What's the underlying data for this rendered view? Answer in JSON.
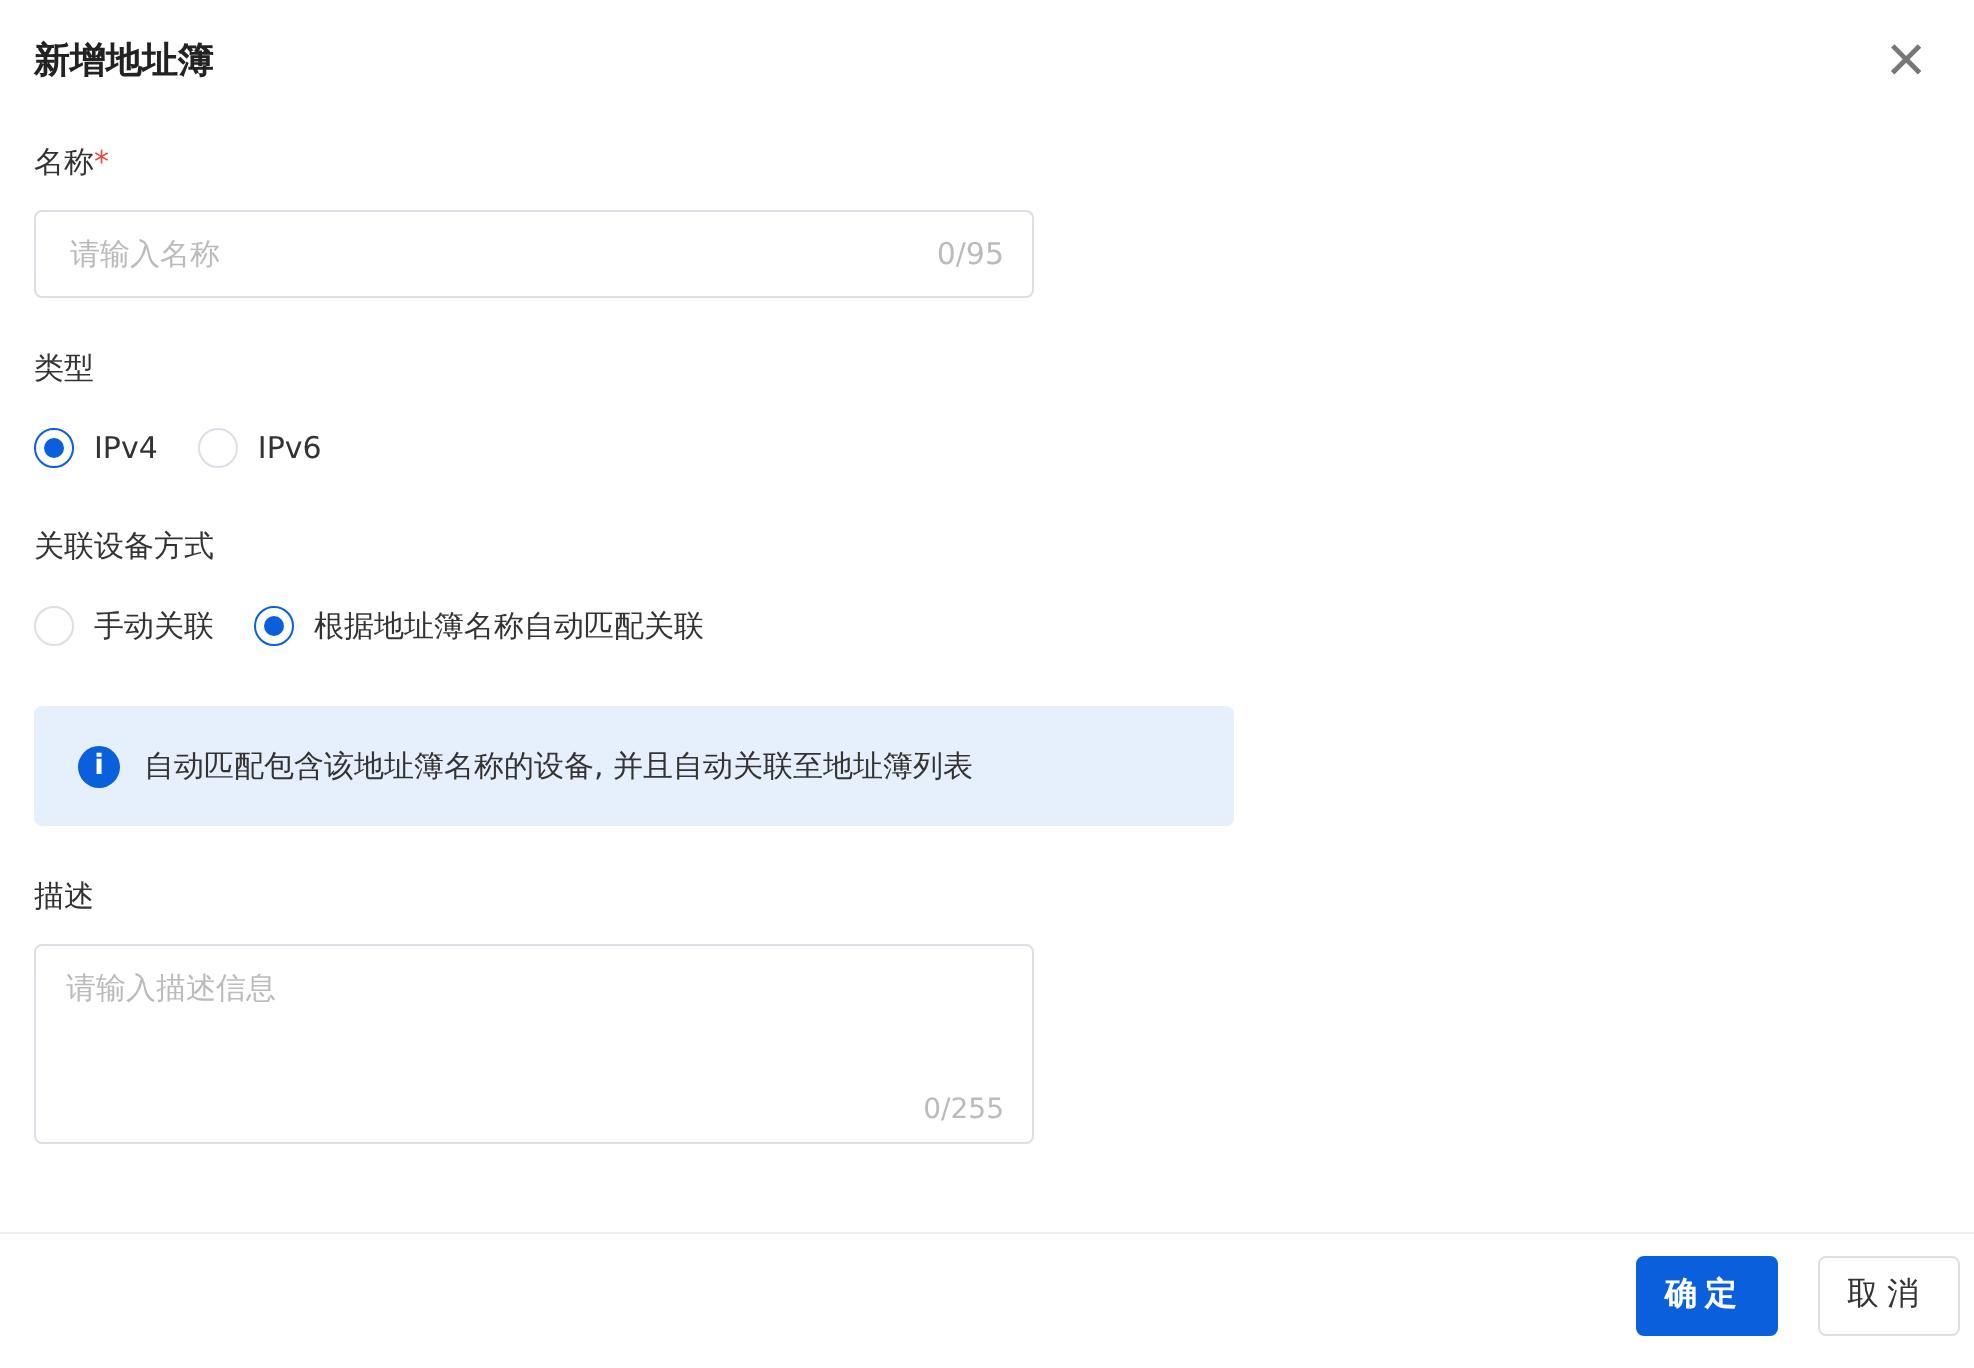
{
  "dialog": {
    "title": "新增地址簿",
    "close": "×"
  },
  "name_field": {
    "label": "名称",
    "required_mark": "*",
    "placeholder": "请输入名称",
    "counter": "0/95"
  },
  "type_group": {
    "label": "类型",
    "options": [
      {
        "label": "IPv4",
        "selected": true
      },
      {
        "label": "IPv6",
        "selected": false
      }
    ]
  },
  "link_group": {
    "label": "关联设备方式",
    "options": [
      {
        "label": "手动关联",
        "selected": false
      },
      {
        "label": "根据地址簿名称自动匹配关联",
        "selected": true
      }
    ]
  },
  "info": {
    "icon": "i",
    "text": "自动匹配包含该地址簿名称的设备, 并且自动关联至地址簿列表"
  },
  "description_field": {
    "label": "描述",
    "placeholder": "请输入描述信息",
    "counter": "0/255"
  },
  "buttons": [
    {
      "label": "确定",
      "kind": "primary"
    },
    {
      "label": "取消",
      "kind": "secondary"
    }
  ]
}
